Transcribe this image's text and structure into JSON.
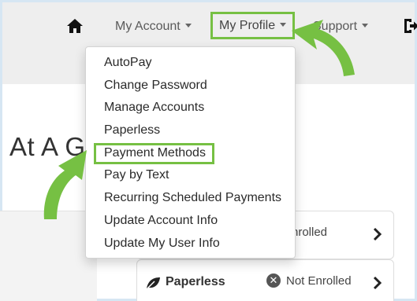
{
  "nav": {
    "home_icon": "home-icon",
    "my_account": "My Account",
    "my_profile": "My Profile",
    "support": "Support",
    "logout_icon": "logout-icon"
  },
  "dropdown": {
    "items": [
      {
        "label": "AutoPay"
      },
      {
        "label": "Change Password"
      },
      {
        "label": "Manage Accounts"
      },
      {
        "label": "Paperless"
      },
      {
        "label": "Payment Methods",
        "highlighted": true
      },
      {
        "label": "Pay by Text"
      },
      {
        "label": "Recurring Scheduled Payments"
      },
      {
        "label": "Update Account Info"
      },
      {
        "label": "Update My User Info"
      }
    ]
  },
  "page": {
    "heading": "At A G"
  },
  "cards": [
    {
      "label": "",
      "status": "nrolled"
    },
    {
      "label": "Paperless",
      "status": "Not Enrolled",
      "status_icon": "x-circle-icon",
      "label_icon": "leaf-icon"
    }
  ],
  "colors": {
    "highlight_green": "#76c043",
    "nav_background": "#eeeeee",
    "frame_blue": "#cfe1f1"
  }
}
